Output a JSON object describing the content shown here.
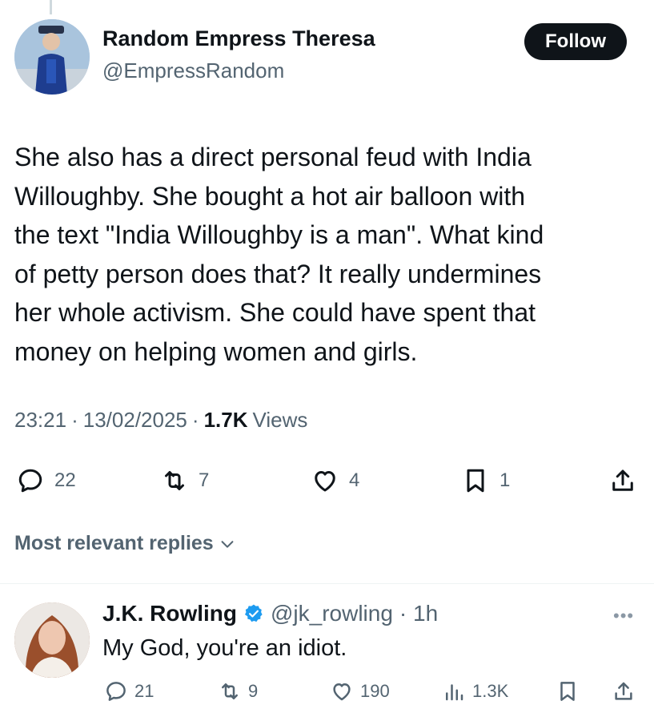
{
  "post": {
    "author_name": "Random Empress Theresa",
    "author_handle": "@EmpressRandom",
    "follow_label": "Follow",
    "text": "She also has a direct personal feud with India\nWilloughby. She bought a hot air balloon with\nthe text \"India Willoughby is a man\". What kind\nof petty person does that? It really undermines\nher whole activism. She could have spent that\nmoney on helping women and girls.",
    "time": "23:21",
    "date": "13/02/2025",
    "views_count": "1.7K",
    "views_label": "Views",
    "sep": "·",
    "stats": {
      "replies": "22",
      "reposts": "7",
      "likes": "4",
      "bookmarks": "1"
    }
  },
  "replies_section": {
    "label": "Most relevant replies"
  },
  "reply": {
    "author_name": "J.K. Rowling",
    "author_handle": "@jk_rowling",
    "age": "· 1h",
    "more": "•••",
    "text": "My God, you're an idiot.",
    "stats": {
      "replies": "21",
      "reposts": "9",
      "likes": "190",
      "views": "1.3K"
    }
  },
  "colors": {
    "text_primary": "#0f1419",
    "text_secondary": "#536471",
    "verified": "#1d9bf0",
    "follow_bg": "#0f1419"
  },
  "icons": [
    "reply-icon",
    "repost-icon",
    "like-icon",
    "bookmark-icon",
    "share-icon",
    "views-icon",
    "verified-icon",
    "chevron-down-icon",
    "more-icon"
  ]
}
